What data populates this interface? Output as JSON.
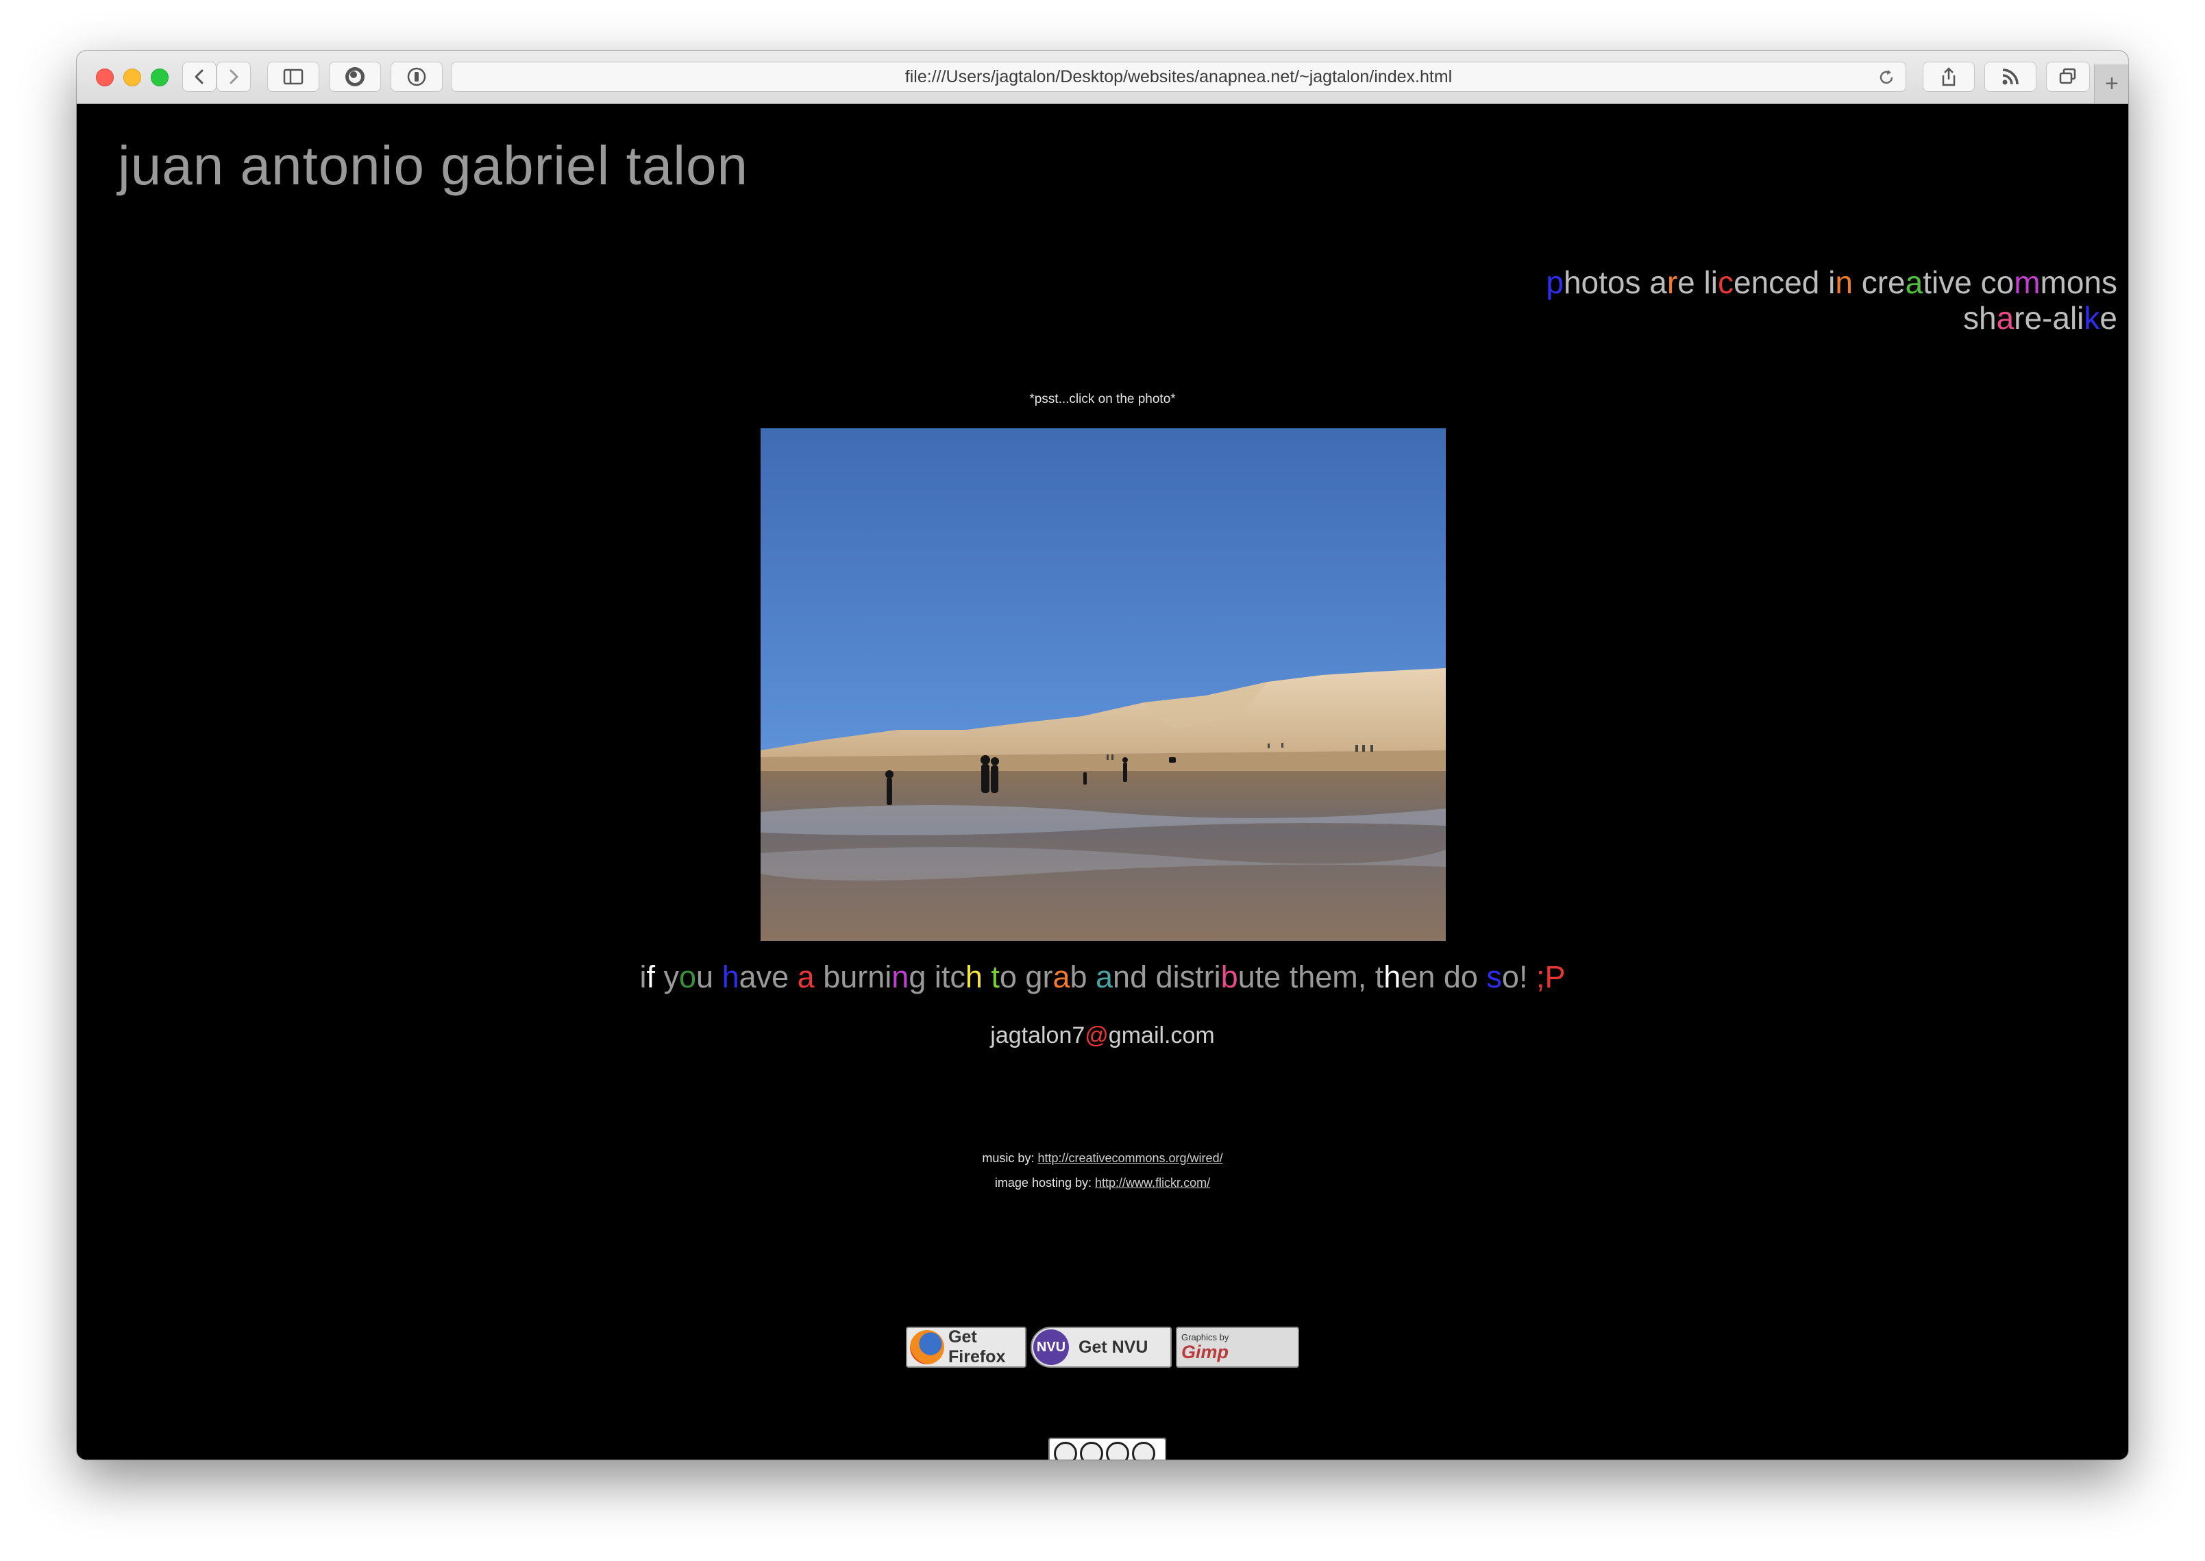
{
  "browser": {
    "url": "file:///Users/jagtalon/Desktop/websites/anapnea.net/~jagtalon/index.html",
    "new_tab_symbol": "+"
  },
  "page": {
    "site_title": "juan antonio gabriel talon",
    "licence_text": "photos are licenced in creative commons share-alike",
    "licence_colored": [
      {
        "t": "p",
        "c": "#2e2ef0"
      },
      {
        "t": "hotos ",
        "c": "#bdbdbd"
      },
      {
        "t": "a",
        "c": "#bdbdbd"
      },
      {
        "t": "r",
        "c": "#f07a2e"
      },
      {
        "t": "e ",
        "c": "#bdbdbd"
      },
      {
        "t": "li",
        "c": "#bdbdbd"
      },
      {
        "t": "c",
        "c": "#e83535"
      },
      {
        "t": "enced ",
        "c": "#bdbdbd"
      },
      {
        "t": "i",
        "c": "#bdbdbd"
      },
      {
        "t": "n",
        "c": "#f07a2e"
      },
      {
        "t": " cre",
        "c": "#bdbdbd"
      },
      {
        "t": "a",
        "c": "#4fbf3f"
      },
      {
        "t": "tive co",
        "c": "#bdbdbd"
      },
      {
        "t": "m",
        "c": "#c040d0"
      },
      {
        "t": "mons",
        "c": "#bdbdbd"
      },
      {
        "t": "\n",
        "c": ""
      },
      {
        "t": "sh",
        "c": "#bdbdbd"
      },
      {
        "t": "a",
        "c": "#e84a8a"
      },
      {
        "t": "re-ali",
        "c": "#bdbdbd"
      },
      {
        "t": "k",
        "c": "#2e2ef0"
      },
      {
        "t": "e",
        "c": "#bdbdbd"
      }
    ],
    "photo_hint": "*psst...click on the photo*",
    "photo_description": "sand dunes landscape",
    "itch_text": "if you have a burning itch to grab and distribute them, then do so! ;P",
    "itch_colored": [
      {
        "t": "i",
        "c": "#9a9a9a"
      },
      {
        "t": "f ",
        "c": "#ffffff"
      },
      {
        "t": "y",
        "c": "#9a9a9a"
      },
      {
        "t": "o",
        "c": "#3c8f3c"
      },
      {
        "t": "u ",
        "c": "#9a9a9a"
      },
      {
        "t": "h",
        "c": "#2e2ef0"
      },
      {
        "t": "ave ",
        "c": "#9a9a9a"
      },
      {
        "t": "a",
        "c": "#e83535"
      },
      {
        "t": " burni",
        "c": "#9a9a9a"
      },
      {
        "t": "n",
        "c": "#c040d0"
      },
      {
        "t": "g itc",
        "c": "#9a9a9a"
      },
      {
        "t": "h",
        "c": "#f5e23a"
      },
      {
        "t": " ",
        "c": "#9a9a9a"
      },
      {
        "t": "t",
        "c": "#7ad13a"
      },
      {
        "t": "o gr",
        "c": "#9a9a9a"
      },
      {
        "t": "a",
        "c": "#f07a2e"
      },
      {
        "t": "b ",
        "c": "#9a9a9a"
      },
      {
        "t": "a",
        "c": "#4aa3a3"
      },
      {
        "t": "nd distri",
        "c": "#9a9a9a"
      },
      {
        "t": "b",
        "c": "#e84a8a"
      },
      {
        "t": "ute them, t",
        "c": "#9a9a9a"
      },
      {
        "t": "h",
        "c": "#ffffff"
      },
      {
        "t": "en d",
        "c": "#9a9a9a"
      },
      {
        "t": "o ",
        "c": "#9a9a9a"
      },
      {
        "t": "s",
        "c": "#2e2ef0"
      },
      {
        "t": "o! ",
        "c": "#9a9a9a"
      },
      {
        "t": ";P",
        "c": "#e83535"
      }
    ],
    "email_user": "jagtalon7",
    "email_at": "@",
    "email_domain": "gmail.com",
    "email_at_color": "#e83535",
    "music_label": "music by:",
    "music_link": "http://creativecommons.org/wired/",
    "hosting_label": "image hosting by:",
    "hosting_link": "http://www.flickr.com/",
    "badges": {
      "firefox": "Get Firefox",
      "nvu_logo": "NVU",
      "nvu": "Get NVU",
      "gimp_small": "Graphics by",
      "gimp": "Gimp"
    }
  },
  "colors": {
    "page_background": "#000000",
    "title": "#9a9a9a"
  }
}
